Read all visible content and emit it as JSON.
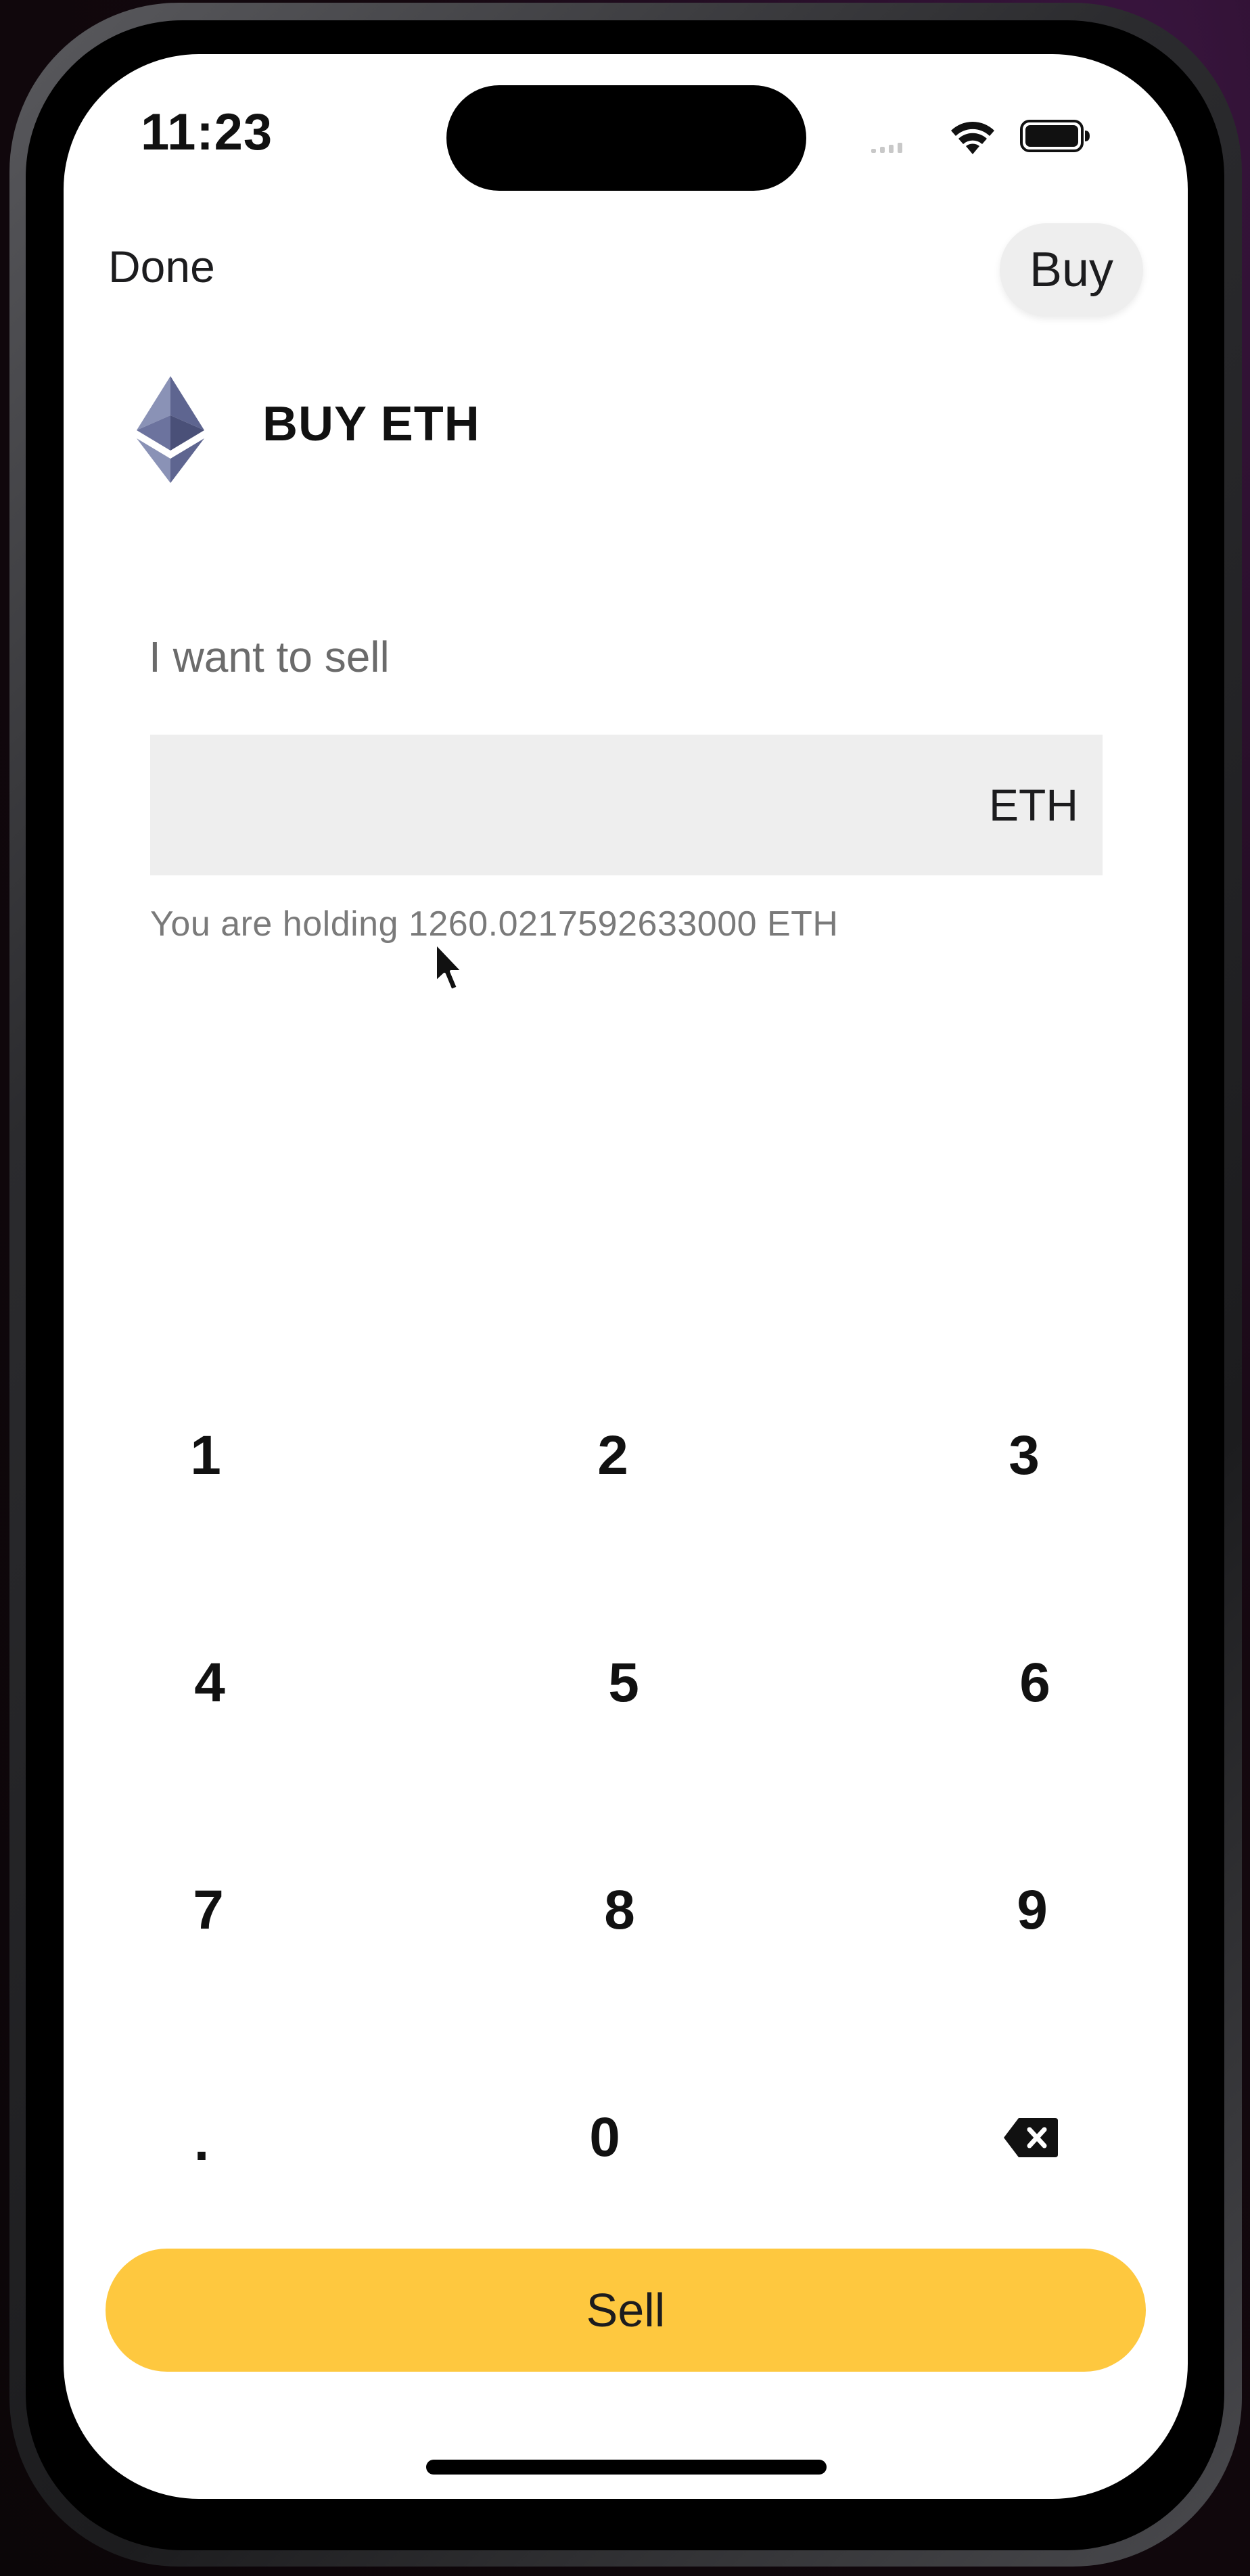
{
  "status_bar": {
    "time": "11:23"
  },
  "header": {
    "done_label": "Done",
    "buy_label": "Buy"
  },
  "asset": {
    "title": "BUY ETH",
    "icon": "ethereum-logo-icon",
    "icon_color": "#6f7cb0"
  },
  "form": {
    "sell_label": "I want to sell",
    "amount_value": "",
    "amount_placeholder": "",
    "currency": "ETH",
    "holding_text": "You are holding 1260.0217592633000 ETH"
  },
  "keypad": {
    "keys": [
      "1",
      "2",
      "3",
      "4",
      "5",
      "6",
      "7",
      "8",
      "9",
      ".",
      "0"
    ],
    "backspace_icon": "backspace-icon"
  },
  "actions": {
    "sell_label": "Sell",
    "sell_color": "#fec83f"
  }
}
